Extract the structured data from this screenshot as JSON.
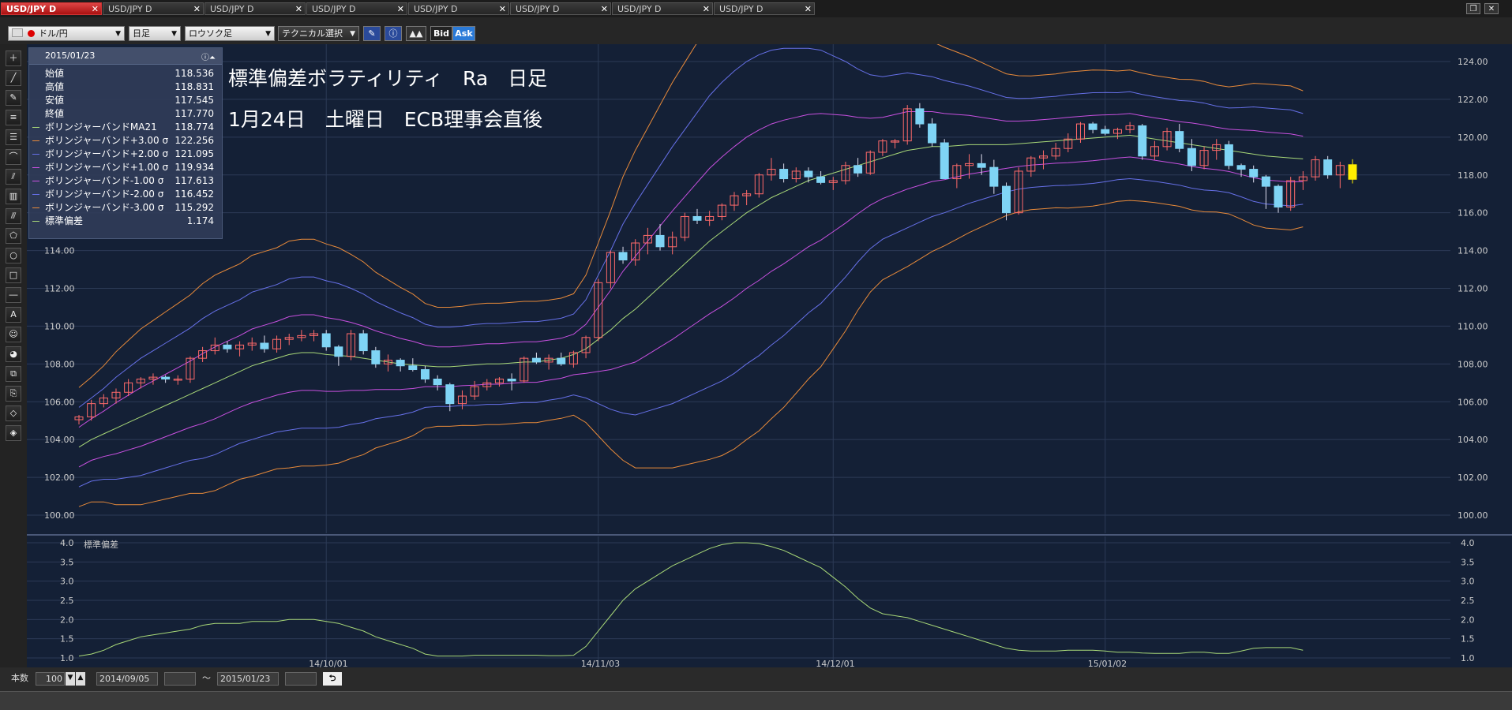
{
  "tabs": [
    {
      "label": "USD/JPY D",
      "active": true
    },
    {
      "label": "USD/JPY D",
      "active": false
    },
    {
      "label": "USD/JPY D",
      "active": false
    },
    {
      "label": "USD/JPY D",
      "active": false
    },
    {
      "label": "USD/JPY D",
      "active": false
    },
    {
      "label": "USD/JPY D",
      "active": false
    },
    {
      "label": "USD/JPY D",
      "active": false
    },
    {
      "label": "USD/JPY D",
      "active": false
    }
  ],
  "toolbar": {
    "pair": "ドル/円",
    "timeframe": "日足",
    "chart_type": "ロウソク足",
    "technical": "テクニカル選択",
    "bid": "Bid",
    "ask": "Ask"
  },
  "info": {
    "date": "2015/01/23",
    "rows": [
      {
        "label": "始値",
        "value": "118.536",
        "color": ""
      },
      {
        "label": "高値",
        "value": "118.831",
        "color": ""
      },
      {
        "label": "安値",
        "value": "117.545",
        "color": ""
      },
      {
        "label": "終値",
        "value": "117.770",
        "color": ""
      },
      {
        "label": "ボリンジャーバンドMA21",
        "value": "118.774",
        "color": "#a8d878"
      },
      {
        "label": "ボリンジャーバンド+3.00 σ",
        "value": "122.256",
        "color": "#e88a3a"
      },
      {
        "label": "ボリンジャーバンド+2.00 σ",
        "value": "121.095",
        "color": "#6670e8"
      },
      {
        "label": "ボリンジャーバンド+1.00 σ",
        "value": "119.934",
        "color": "#c850e0"
      },
      {
        "label": "ボリンジャーバンド-1.00 σ",
        "value": "117.613",
        "color": "#c850e0"
      },
      {
        "label": "ボリンジャーバンド-2.00 σ",
        "value": "116.452",
        "color": "#6670e8"
      },
      {
        "label": "ボリンジャーバンド-3.00 σ",
        "value": "115.292",
        "color": "#e88a3a"
      },
      {
        "label": "標準偏差",
        "value": "1.174",
        "color": "#a8d878"
      }
    ]
  },
  "annotation": {
    "line1": "標準偏差ボラティリティ　Ra　日足",
    "line2": "1月24日　土曜日　ECB理事会直後"
  },
  "sub_label": "標準偏差",
  "bottom": {
    "count_label": "本数",
    "count_value": "100",
    "from_date": "2014/09/05",
    "tilde": "～",
    "to_date": "2015/01/23"
  },
  "colors": {
    "bg": "#142036",
    "up": "#ff6a6a",
    "down": "#7fd4f5",
    "last": "#ffee00",
    "ma": "#a8d878",
    "s1": "#c850e0",
    "s2": "#6670e8",
    "s3": "#e88a3a"
  },
  "chart_data": [
    {
      "type": "candlestick",
      "title": "",
      "ylim": [
        100,
        124
      ],
      "y_ticks": [
        "100.00",
        "102.00",
        "104.00",
        "106.00",
        "108.00",
        "110.00",
        "112.00",
        "114.00",
        "116.00",
        "118.00",
        "120.00",
        "122.00",
        "124.00"
      ],
      "x_ticks": [
        {
          "label": "14/10/01",
          "index": 20
        },
        {
          "label": "14/11/03",
          "index": 42
        },
        {
          "label": "14/12/01",
          "index": 61
        },
        {
          "label": "15/01/02",
          "index": 83
        }
      ],
      "ohlc": [
        [
          105.05,
          105.3,
          104.8,
          105.2
        ],
        [
          105.2,
          106.1,
          105.0,
          105.9
        ],
        [
          105.9,
          106.4,
          105.7,
          106.2
        ],
        [
          106.2,
          106.7,
          105.9,
          106.5
        ],
        [
          106.5,
          107.2,
          106.3,
          107.0
        ],
        [
          107.0,
          107.3,
          106.7,
          107.2
        ],
        [
          107.2,
          107.5,
          106.9,
          107.3
        ],
        [
          107.3,
          107.4,
          107.0,
          107.2
        ],
        [
          107.2,
          107.4,
          106.9,
          107.2
        ],
        [
          107.2,
          108.4,
          107.0,
          108.3
        ],
        [
          108.3,
          108.9,
          108.1,
          108.7
        ],
        [
          108.7,
          109.4,
          108.5,
          109.0
        ],
        [
          109.0,
          109.2,
          108.6,
          108.8
        ],
        [
          108.8,
          109.2,
          108.4,
          109.0
        ],
        [
          109.0,
          109.4,
          108.7,
          109.1
        ],
        [
          109.1,
          109.5,
          108.6,
          108.8
        ],
        [
          108.8,
          109.5,
          108.6,
          109.3
        ],
        [
          109.3,
          109.6,
          109.0,
          109.4
        ],
        [
          109.4,
          109.8,
          109.2,
          109.5
        ],
        [
          109.5,
          109.8,
          109.2,
          109.6
        ],
        [
          109.6,
          109.8,
          108.7,
          108.9
        ],
        [
          108.9,
          109.0,
          107.9,
          108.4
        ],
        [
          108.4,
          109.8,
          108.2,
          109.6
        ],
        [
          109.6,
          109.8,
          108.5,
          108.7
        ],
        [
          108.7,
          108.9,
          107.8,
          108.0
        ],
        [
          108.0,
          108.5,
          107.6,
          108.2
        ],
        [
          108.2,
          108.3,
          107.6,
          107.9
        ],
        [
          107.9,
          108.3,
          107.6,
          107.7
        ],
        [
          107.7,
          107.9,
          107.0,
          107.2
        ],
        [
          107.2,
          107.4,
          106.6,
          106.9
        ],
        [
          106.9,
          107.0,
          105.5,
          105.9
        ],
        [
          105.9,
          106.6,
          105.6,
          106.3
        ],
        [
          106.3,
          107.1,
          106.1,
          106.8
        ],
        [
          106.8,
          107.2,
          106.6,
          107.0
        ],
        [
          107.0,
          107.3,
          106.8,
          107.2
        ],
        [
          107.2,
          107.5,
          106.6,
          107.1
        ],
        [
          107.1,
          108.4,
          107.0,
          108.3
        ],
        [
          108.3,
          108.6,
          108.0,
          108.1
        ],
        [
          108.1,
          108.5,
          107.7,
          108.3
        ],
        [
          108.3,
          108.6,
          107.9,
          108.0
        ],
        [
          108.0,
          108.7,
          107.8,
          108.6
        ],
        [
          108.6,
          109.5,
          108.3,
          109.4
        ],
        [
          109.4,
          112.5,
          109.2,
          112.3
        ],
        [
          112.3,
          114.0,
          112.0,
          113.9
        ],
        [
          113.9,
          114.2,
          113.3,
          113.5
        ],
        [
          113.5,
          114.6,
          113.2,
          114.4
        ],
        [
          114.4,
          115.2,
          113.8,
          114.8
        ],
        [
          114.8,
          115.4,
          114.0,
          114.2
        ],
        [
          114.2,
          115.0,
          113.8,
          114.7
        ],
        [
          114.7,
          116.0,
          114.5,
          115.8
        ],
        [
          115.8,
          116.2,
          115.4,
          115.6
        ],
        [
          115.6,
          116.1,
          115.3,
          115.8
        ],
        [
          115.8,
          116.5,
          115.6,
          116.4
        ],
        [
          116.4,
          117.1,
          116.1,
          116.9
        ],
        [
          116.9,
          117.2,
          116.4,
          117.0
        ],
        [
          117.0,
          118.1,
          116.8,
          118.0
        ],
        [
          118.0,
          118.9,
          117.7,
          118.3
        ],
        [
          118.3,
          118.6,
          117.6,
          117.8
        ],
        [
          117.8,
          118.4,
          117.6,
          118.2
        ],
        [
          118.2,
          118.4,
          117.6,
          117.9
        ],
        [
          117.9,
          118.2,
          117.5,
          117.6
        ],
        [
          117.6,
          117.9,
          117.2,
          117.7
        ],
        [
          117.7,
          118.7,
          117.5,
          118.5
        ],
        [
          118.5,
          118.9,
          117.9,
          118.1
        ],
        [
          118.1,
          119.3,
          118.0,
          119.2
        ],
        [
          119.2,
          119.9,
          119.0,
          119.8
        ],
        [
          119.8,
          119.9,
          119.4,
          119.8
        ],
        [
          119.8,
          121.7,
          119.6,
          121.5
        ],
        [
          121.5,
          121.8,
          120.5,
          120.7
        ],
        [
          120.7,
          121.0,
          119.5,
          119.7
        ],
        [
          119.7,
          119.9,
          117.8,
          117.8
        ],
        [
          117.8,
          118.6,
          117.3,
          118.5
        ],
        [
          118.5,
          119.1,
          117.8,
          118.6
        ],
        [
          118.6,
          119.1,
          118.0,
          118.4
        ],
        [
          118.4,
          118.8,
          117.0,
          117.4
        ],
        [
          117.4,
          117.6,
          115.6,
          116.0
        ],
        [
          116.0,
          118.4,
          115.9,
          118.2
        ],
        [
          118.2,
          119.0,
          117.9,
          118.9
        ],
        [
          118.9,
          119.3,
          118.3,
          119.0
        ],
        [
          119.0,
          119.7,
          118.8,
          119.4
        ],
        [
          119.4,
          120.2,
          119.2,
          119.9
        ],
        [
          119.9,
          120.8,
          119.7,
          120.7
        ],
        [
          120.7,
          120.8,
          120.2,
          120.4
        ],
        [
          120.4,
          120.6,
          120.1,
          120.2
        ],
        [
          120.2,
          120.5,
          119.9,
          120.4
        ],
        [
          120.4,
          120.8,
          120.2,
          120.6
        ],
        [
          120.6,
          120.7,
          118.8,
          119.0
        ],
        [
          119.0,
          119.8,
          118.8,
          119.5
        ],
        [
          119.5,
          120.5,
          119.3,
          120.3
        ],
        [
          120.3,
          120.7,
          119.2,
          119.4
        ],
        [
          119.4,
          119.9,
          118.2,
          118.5
        ],
        [
          118.5,
          119.5,
          118.3,
          119.3
        ],
        [
          119.3,
          119.9,
          118.8,
          119.6
        ],
        [
          119.6,
          119.8,
          118.3,
          118.5
        ],
        [
          118.5,
          118.6,
          117.9,
          118.3
        ],
        [
          118.3,
          118.5,
          117.6,
          117.9
        ],
        [
          117.9,
          118.0,
          116.2,
          117.4
        ],
        [
          117.4,
          117.5,
          116.0,
          116.3
        ],
        [
          116.3,
          117.9,
          116.1,
          117.7
        ],
        [
          117.7,
          118.2,
          117.2,
          117.9
        ],
        [
          117.9,
          119.0,
          117.7,
          118.8
        ],
        [
          118.8,
          119.0,
          117.8,
          118.0
        ],
        [
          118.0,
          118.7,
          117.3,
          118.5
        ],
        [
          118.54,
          118.83,
          117.55,
          117.77
        ]
      ],
      "bands": {
        "ma": [
          103.6,
          104.0,
          104.3,
          104.6,
          104.9,
          105.2,
          105.5,
          105.8,
          106.1,
          106.4,
          106.7,
          107.0,
          107.3,
          107.6,
          107.9,
          108.1,
          108.3,
          108.5,
          108.6,
          108.6,
          108.5,
          108.45,
          108.4,
          108.3,
          108.2,
          108.1,
          108.0,
          107.95,
          107.9,
          107.85,
          107.85,
          107.9,
          107.95,
          108.0,
          108.0,
          108.05,
          108.1,
          108.1,
          108.2,
          108.3,
          108.5,
          108.8,
          109.3,
          109.8,
          110.4,
          110.9,
          111.5,
          112.1,
          112.7,
          113.3,
          113.9,
          114.5,
          115.0,
          115.5,
          116.0,
          116.4,
          116.8,
          117.1,
          117.4,
          117.7,
          117.9,
          118.1,
          118.3,
          118.5,
          118.7,
          118.9,
          119.1,
          119.3,
          119.4,
          119.5,
          119.5,
          119.55,
          119.6,
          119.6,
          119.6,
          119.6,
          119.65,
          119.7,
          119.75,
          119.8,
          119.85,
          119.9,
          119.95,
          120.0,
          120.05,
          120.1,
          120.0,
          119.9,
          119.8,
          119.7,
          119.6,
          119.5,
          119.4,
          119.3,
          119.2,
          119.1,
          119.0,
          118.95,
          118.9,
          118.85
        ],
        "sigma": [
          1.05,
          1.1,
          1.2,
          1.35,
          1.45,
          1.55,
          1.6,
          1.65,
          1.7,
          1.75,
          1.85,
          1.9,
          1.9,
          1.9,
          1.95,
          1.95,
          1.95,
          2.0,
          2.0,
          2.0,
          1.95,
          1.9,
          1.8,
          1.7,
          1.55,
          1.45,
          1.35,
          1.25,
          1.1,
          1.05,
          1.05,
          1.05,
          1.07,
          1.07,
          1.07,
          1.07,
          1.07,
          1.07,
          1.06,
          1.06,
          1.07,
          1.3,
          1.7,
          2.1,
          2.5,
          2.8,
          3.0,
          3.2,
          3.4,
          3.55,
          3.7,
          3.85,
          3.95,
          4.0,
          4.0,
          3.98,
          3.9,
          3.8,
          3.65,
          3.5,
          3.35,
          3.1,
          2.85,
          2.55,
          2.3,
          2.15,
          2.1,
          2.05,
          1.95,
          1.85,
          1.75,
          1.65,
          1.55,
          1.45,
          1.35,
          1.25,
          1.2,
          1.18,
          1.18,
          1.18,
          1.2,
          1.2,
          1.2,
          1.18,
          1.15,
          1.15,
          1.13,
          1.12,
          1.12,
          1.12,
          1.15,
          1.15,
          1.12,
          1.12,
          1.18,
          1.25,
          1.27,
          1.27,
          1.27,
          1.2
        ]
      }
    },
    {
      "type": "line",
      "title": "標準偏差",
      "ylim": [
        1.0,
        4.0
      ],
      "y_ticks": [
        "1.0",
        "1.5",
        "2.0",
        "2.5",
        "3.0",
        "3.5",
        "4.0"
      ],
      "series_ref": "bands.sigma"
    }
  ]
}
